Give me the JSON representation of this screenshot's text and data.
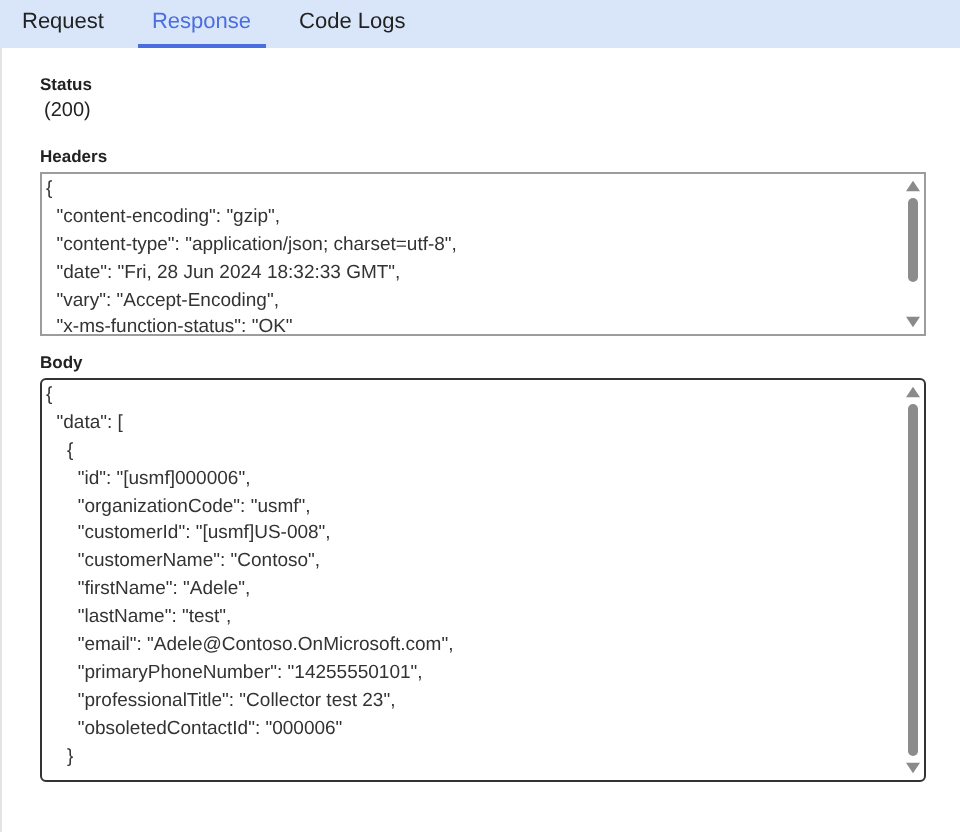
{
  "tabs": [
    {
      "label": "Request",
      "selected": false
    },
    {
      "label": "Response",
      "selected": true
    },
    {
      "label": "Code Logs",
      "selected": false
    }
  ],
  "status": {
    "label": "Status",
    "value": "(200)"
  },
  "headers": {
    "label": "Headers",
    "lines": [
      "{",
      "  \"content-encoding\": \"gzip\",",
      "  \"content-type\": \"application/json; charset=utf-8\",",
      "  \"date\": \"Fri, 28 Jun 2024 18:32:33 GMT\",",
      "  \"vary\": \"Accept-Encoding\",",
      "  \"x-ms-function-status\": \"OK\""
    ]
  },
  "body": {
    "label": "Body",
    "focused": true,
    "lines": [
      "{",
      "  \"data\": [",
      "    {",
      "      \"id\": \"[usmf]000006\",",
      "      \"organizationCode\": \"usmf\",",
      "      \"customerId\": \"[usmf]US-008\",",
      "      \"customerName\": \"Contoso\",",
      "      \"firstName\": \"Adele\",",
      "      \"lastName\": \"test\",",
      "      \"email\": \"Adele@Contoso.OnMicrosoft.com\",",
      "      \"primaryPhoneNumber\": \"14255550101\",",
      "      \"professionalTitle\": \"Collector test 23\",",
      "      \"obsoletedContactId\": \"000006\"",
      "    }"
    ]
  }
}
